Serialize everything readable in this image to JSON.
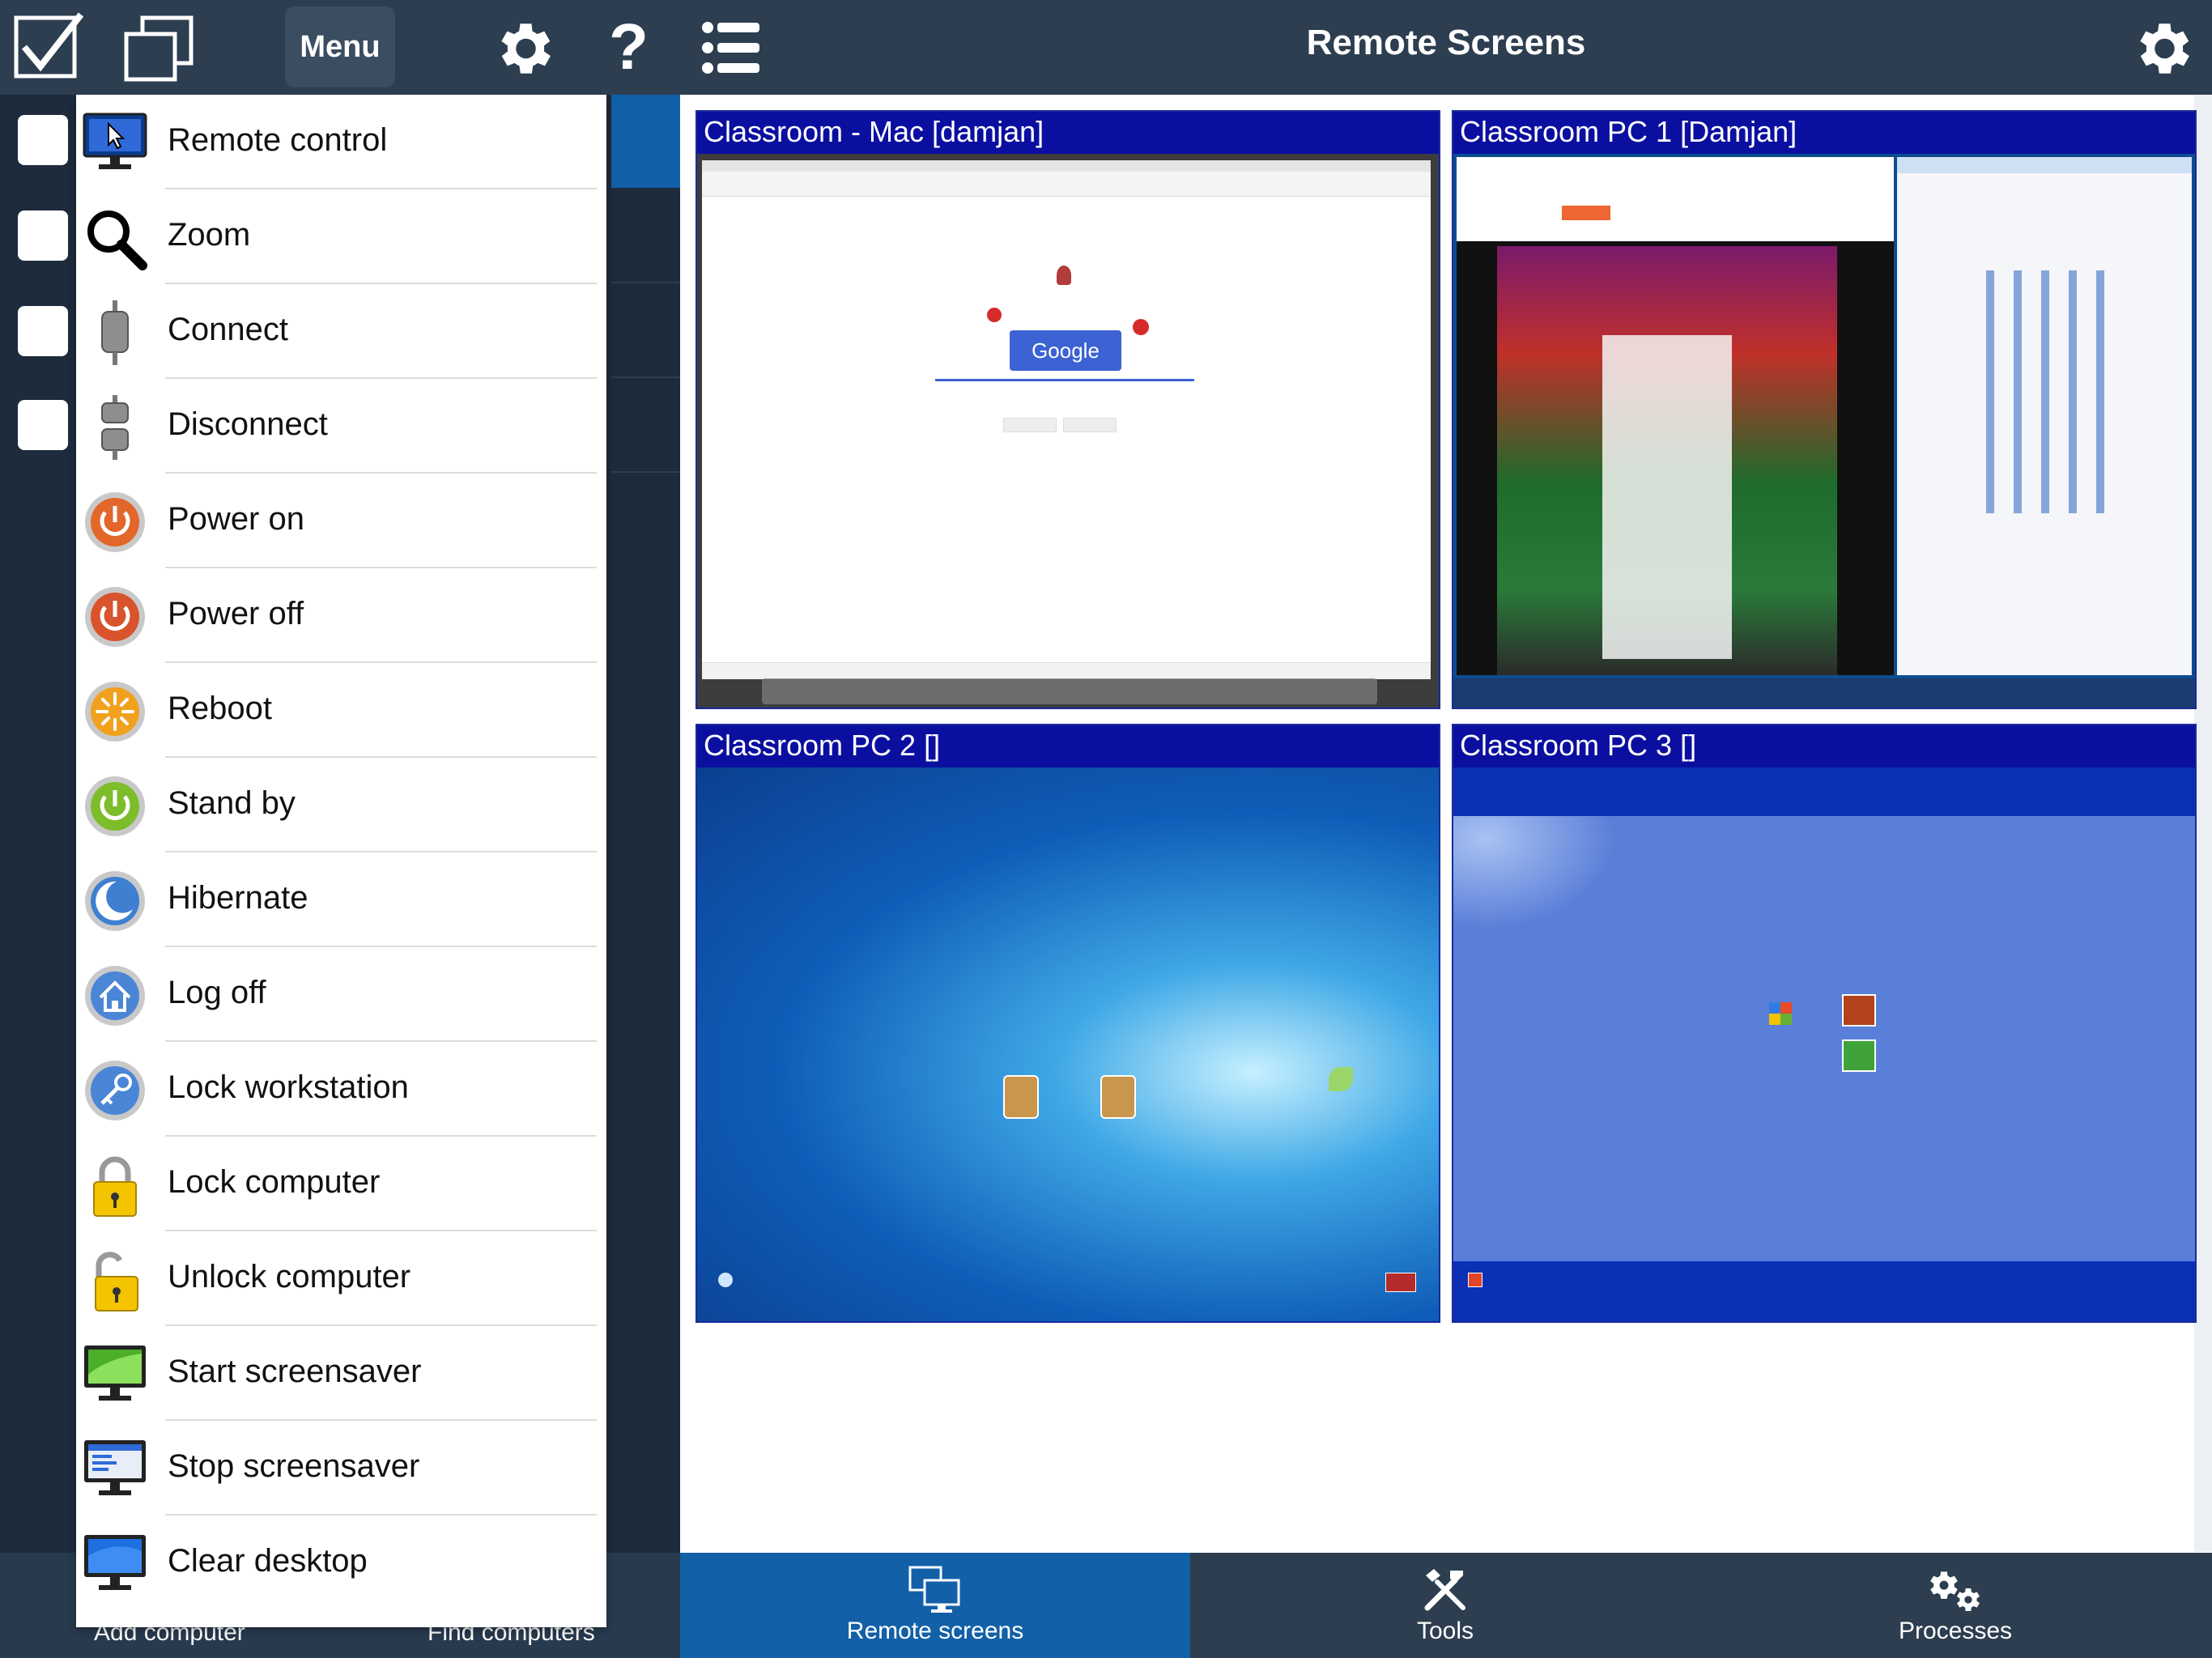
{
  "left_toolbar": {
    "menu_label": "Menu"
  },
  "left_bottom": {
    "add_computer": "Add computer",
    "find_computers": "Find computers"
  },
  "menu": {
    "items": [
      {
        "label": "Remote control",
        "icon": "remote-control-icon"
      },
      {
        "label": "Zoom",
        "icon": "zoom-icon"
      },
      {
        "label": "Connect",
        "icon": "connect-plug-icon"
      },
      {
        "label": "Disconnect",
        "icon": "disconnect-plug-icon"
      },
      {
        "label": "Power on",
        "icon": "power-on-icon"
      },
      {
        "label": "Power off",
        "icon": "power-off-icon"
      },
      {
        "label": "Reboot",
        "icon": "reboot-icon"
      },
      {
        "label": "Stand by",
        "icon": "stand-by-icon"
      },
      {
        "label": "Hibernate",
        "icon": "hibernate-icon"
      },
      {
        "label": "Log off",
        "icon": "log-off-icon"
      },
      {
        "label": "Lock workstation",
        "icon": "lock-workstation-icon"
      },
      {
        "label": "Lock computer",
        "icon": "lock-closed-icon"
      },
      {
        "label": "Unlock computer",
        "icon": "lock-open-icon"
      },
      {
        "label": "Start screensaver",
        "icon": "start-screensaver-icon"
      },
      {
        "label": "Stop screensaver",
        "icon": "stop-screensaver-icon"
      },
      {
        "label": "Clear desktop",
        "icon": "clear-desktop-icon"
      }
    ]
  },
  "header": {
    "title": "Remote Screens"
  },
  "screens": [
    {
      "title": "Classroom - Mac [damjan]"
    },
    {
      "title": "Classroom PC 1 [Damjan]"
    },
    {
      "title": "Classroom PC 2 []"
    },
    {
      "title": "Classroom PC 3 []"
    }
  ],
  "mac_screen": {
    "button_text": "Google"
  },
  "tabs": [
    {
      "label": "Remote screens",
      "active": true
    },
    {
      "label": "Tools",
      "active": false
    },
    {
      "label": "Processes",
      "active": false
    }
  ],
  "colors": {
    "toolbar": "#2c3e50",
    "accent": "#1260a8",
    "tile_header": "#0b0fa0"
  }
}
